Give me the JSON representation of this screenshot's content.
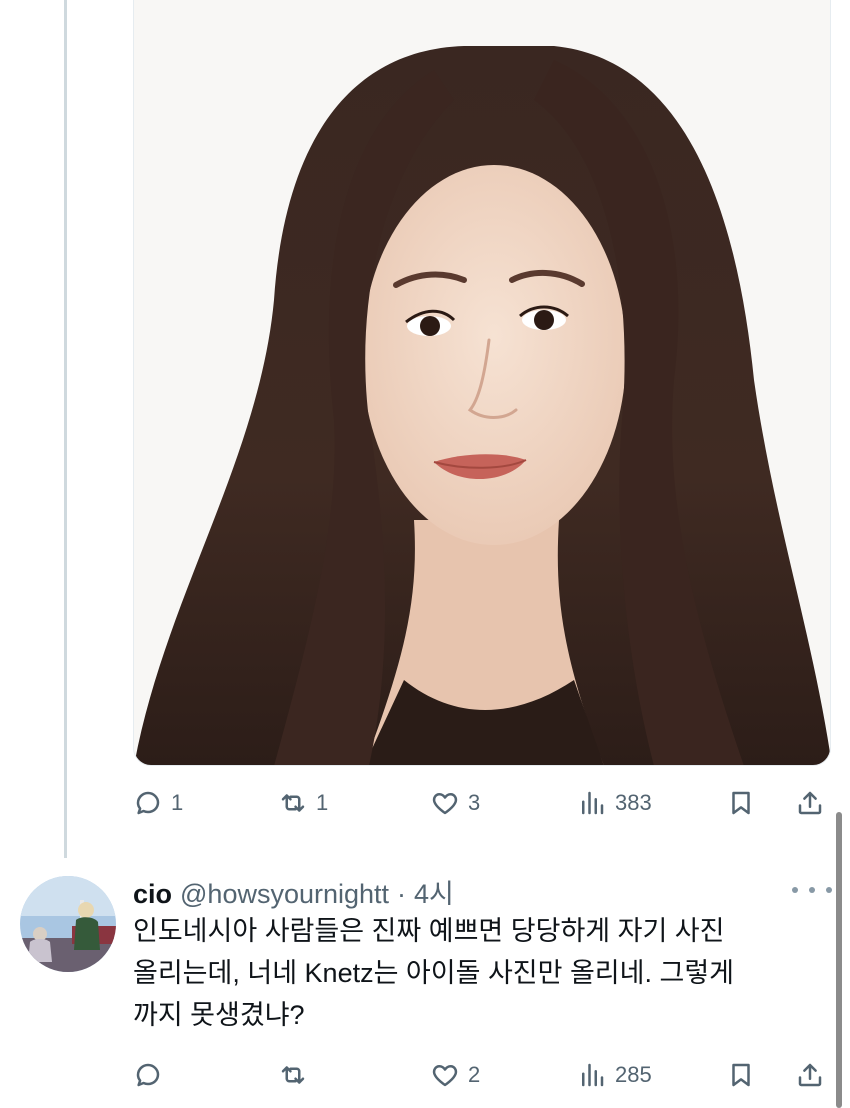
{
  "tweet": {
    "stats": {
      "replies": "1",
      "retweets": "1",
      "likes": "3",
      "views": "383"
    }
  },
  "reply": {
    "display_name": "cio",
    "handle": "@howsyournightt",
    "separator": "·",
    "time": "4시",
    "text_lines": [
      "인도네시아 사람들은 진짜 예쁘면 당당하게 자기 사진",
      "올리는데, 너네 Knetz는 아이돌 사진만 올리네. 그렇게",
      "까지 못생겼냐?"
    ],
    "stats": {
      "replies": "",
      "retweets": "",
      "likes": "2",
      "views": "285"
    }
  },
  "icons": [
    "reply-icon",
    "retweet-icon",
    "like-icon",
    "views-icon",
    "bookmark-icon",
    "share-icon",
    "more-icon"
  ],
  "colors": {
    "icon_gray": "#536471",
    "text": "#0f1419",
    "thread_line": "#cfd9de"
  }
}
